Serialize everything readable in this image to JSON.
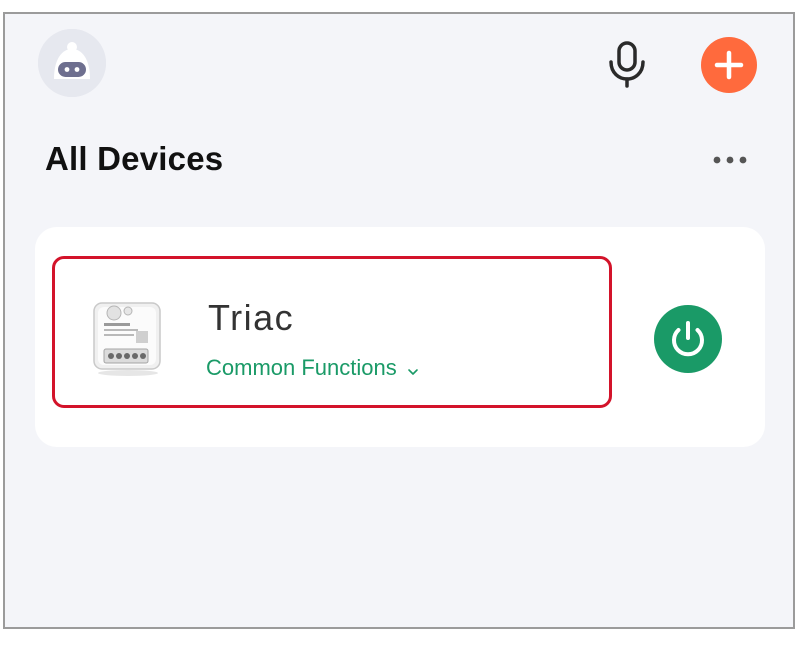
{
  "header": {
    "avatar_icon": "robot-avatar-icon",
    "mic_icon": "microphone-icon",
    "add_icon": "plus-icon",
    "add_color": "#ff6a3d"
  },
  "section": {
    "title": "All Devices",
    "more_icon": "more-horizontal-icon"
  },
  "device": {
    "name": "Triac",
    "functions_label": "Common Functions",
    "chevron_icon": "chevron-down-icon",
    "power_icon": "power-icon",
    "accent_color": "#1a9a67",
    "highlight_color": "#d3132a"
  }
}
